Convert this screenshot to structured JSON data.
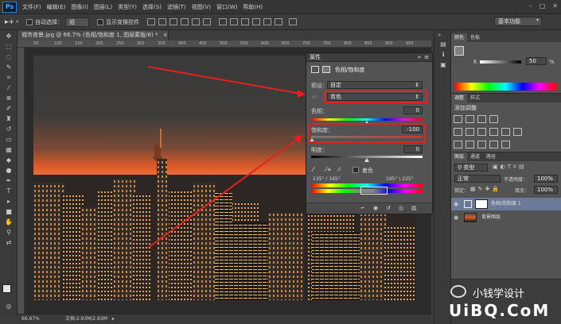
{
  "app": {
    "logo": "Ps"
  },
  "menu": [
    "文件(F)",
    "编辑(E)",
    "图像(I)",
    "图层(L)",
    "类型(Y)",
    "选择(S)",
    "滤镜(T)",
    "视图(V)",
    "窗口(W)",
    "帮助(H)"
  ],
  "window_controls": {
    "minimize": "–",
    "restore": "□",
    "close": "✕"
  },
  "options_bar": {
    "auto_select_label": "自动选择：",
    "auto_select_value": "组",
    "show_transform_label": "显示变换控件",
    "workspace": "基本功能"
  },
  "document": {
    "tab_title": "城市夜景.jpg @ 66.7% (色相/饱和度 1, 图层蒙版/8) *",
    "tab_close": "×",
    "ruler_marks": [
      "50",
      "100",
      "150",
      "200",
      "250",
      "300",
      "350",
      "400",
      "450",
      "500",
      "550",
      "600",
      "650",
      "700",
      "750",
      "800",
      "850",
      "900",
      "950"
    ],
    "zoom": "66.67%",
    "doc_info": "文档:2.93M/2.93M"
  },
  "properties": {
    "panel_title": "属性",
    "adj_title": "色相/饱和度",
    "preset_label": "预设：",
    "preset_value": "自定",
    "channel_value": "青色",
    "hue_label": "色相：",
    "hue_value": "0",
    "saturation_label": "饱和度：",
    "saturation_value": "-100",
    "lightness_label": "明度：",
    "lightness_value": "0",
    "colorize_label": "着色",
    "range_left": "135° / 165°",
    "range_right": "195° \\ 225°"
  },
  "color_panel": {
    "tabs": [
      "颜色",
      "色板"
    ],
    "channel_label": "K",
    "value": "50",
    "unit": "%"
  },
  "adjustments_panel": {
    "tabs": [
      "调整",
      "样式"
    ],
    "heading": "添加调整"
  },
  "layers_panel": {
    "tabs": [
      "图层",
      "通道",
      "路径"
    ],
    "filter_type": "类型",
    "blend_mode": "正常",
    "opacity_label": "不透明度：",
    "opacity_value": "100%",
    "lock_label": "锁定：",
    "fill_label": "填充：",
    "fill_value": "100%",
    "layers": [
      {
        "name": "色相/饱和度 1",
        "selected": true
      },
      {
        "name": "背景图层",
        "selected": false
      }
    ]
  },
  "watermark": {
    "line1": "小钱学设计",
    "line2": "UiBQ.CoM"
  },
  "colors": {
    "accent_red": "#e3221f",
    "panel_bg": "#535353",
    "app_bg": "#3c3c3c",
    "selected_layer": "#6b7a99"
  }
}
